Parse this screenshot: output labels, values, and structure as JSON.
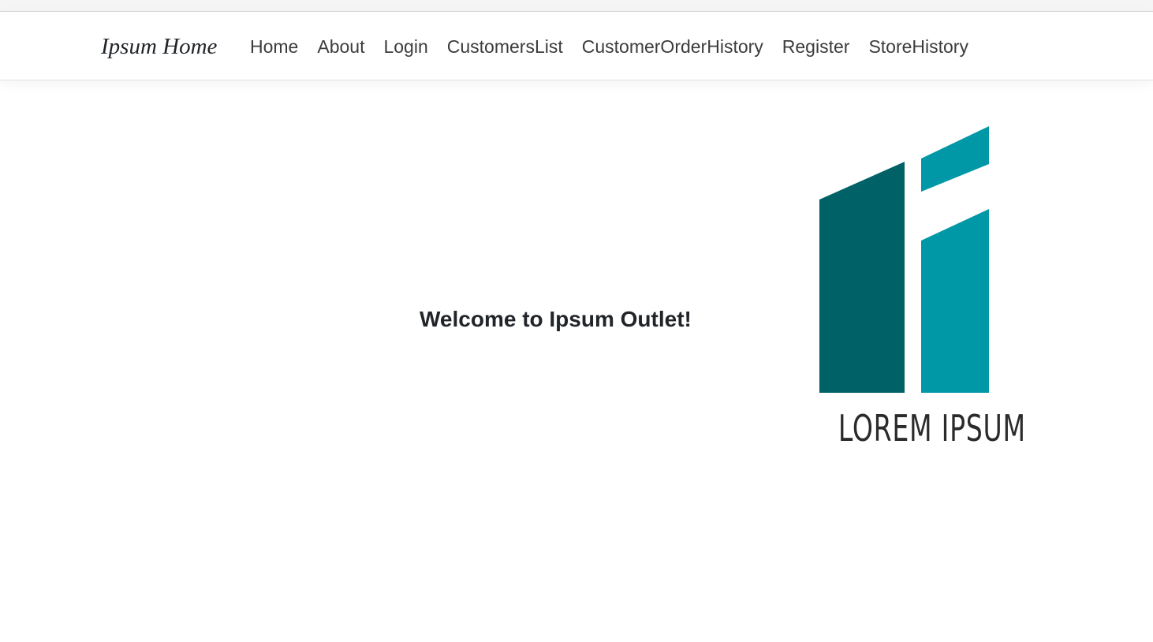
{
  "navbar": {
    "brand": "Ipsum Home",
    "links": [
      {
        "label": "Home"
      },
      {
        "label": "About"
      },
      {
        "label": "Login"
      },
      {
        "label": "CustomersList"
      },
      {
        "label": "CustomerOrderHistory"
      },
      {
        "label": "Register"
      },
      {
        "label": "StoreHistory"
      }
    ]
  },
  "main": {
    "welcome_text": "Welcome to Ipsum Outlet!"
  },
  "logo": {
    "text": "LOREM IPSUM",
    "colors": {
      "dark_teal": "#006266",
      "light_teal": "#0097a7"
    }
  }
}
